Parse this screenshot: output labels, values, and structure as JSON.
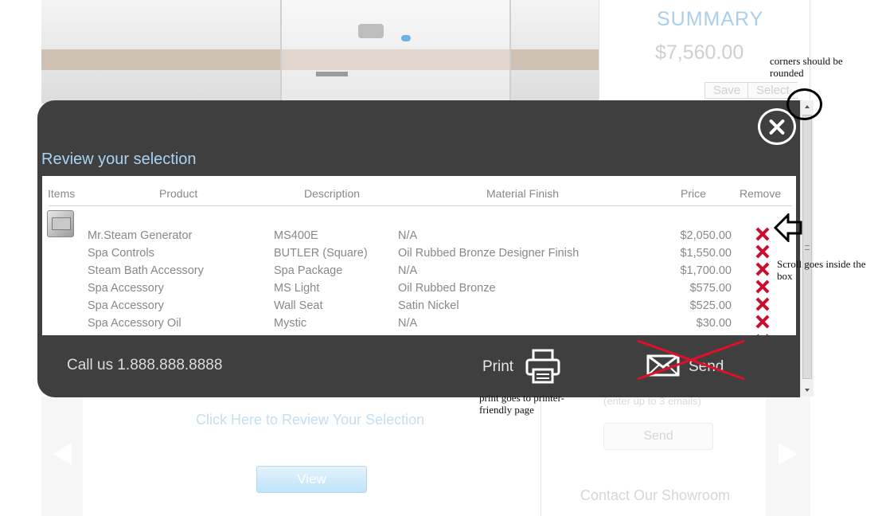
{
  "summary": {
    "title": "SUMMARY",
    "total": "$7,560.00",
    "save_label": "Save",
    "select_label": "Select"
  },
  "modal": {
    "title": "Review your selection",
    "headers": {
      "items": "Items",
      "product": "Product",
      "description": "Description",
      "finish": "Material Finish",
      "price": "Price",
      "remove": "Remove"
    },
    "rows": [
      {
        "product": "Mr.Steam Generator",
        "description": "MS400E",
        "finish": "N/A",
        "price": "$2,050.00"
      },
      {
        "product": "Spa Controls",
        "description": "BUTLER (Square)",
        "finish": "Oil Rubbed Bronze Designer Finish",
        "price": "$1,550.00"
      },
      {
        "product": "Steam Bath Accessory",
        "description": "Spa Package",
        "finish": "N/A",
        "price": "$1,700.00"
      },
      {
        "product": "Spa Accessory",
        "description": "MS Light",
        "finish": "Oil Rubbed Bronze",
        "price": "$575.00"
      },
      {
        "product": "Spa Accessory",
        "description": "Wall Seat",
        "finish": "Satin Nickel",
        "price": "$525.00"
      },
      {
        "product": "Spa Accessory Oil",
        "description": "Mystic",
        "finish": "N/A",
        "price": "$30.00"
      }
    ],
    "call_us": "Call us 1.888.888.8888",
    "print_label": "Print",
    "send_label": "Send"
  },
  "background": {
    "review_link": "Click Here to Review Your Selection",
    "view_label": "View",
    "emails_hint": "(enter up to 3 emails)",
    "send_label": "Send",
    "contact": "Contact Our Showroom"
  },
  "annotations": {
    "corners": "corners should be rounded",
    "scroll": "Scroll goes inside the box",
    "print": "print goes to printer-friendly page"
  },
  "icons": {
    "close": "close-icon",
    "print": "printer-icon",
    "send": "envelope-icon",
    "remove": "remove-x-icon"
  },
  "colors": {
    "modal_bg": "#3f3f3f",
    "title_blue": "#a9d3f2",
    "remove_red": "#c8102e",
    "strike_red": "#e0102a"
  }
}
